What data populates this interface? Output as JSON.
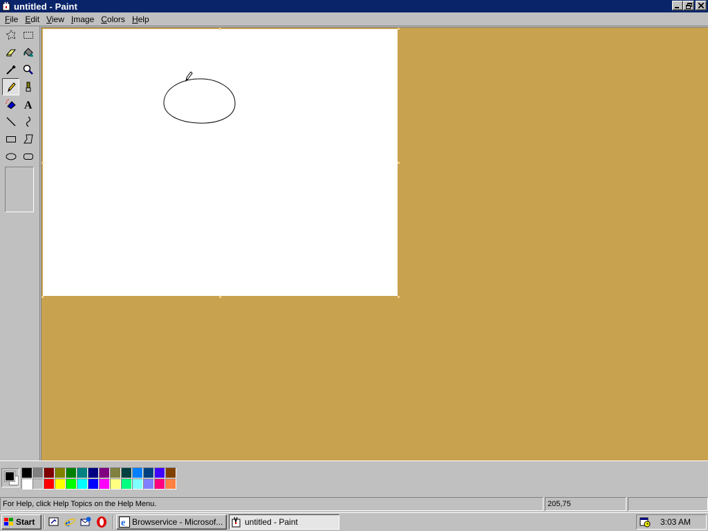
{
  "window": {
    "title": "untitled - Paint",
    "minimize_icon": "minimize-icon",
    "restore_icon": "restore-icon",
    "close_icon": "close-icon"
  },
  "menu": [
    {
      "label": "File",
      "accel": "F",
      "rest": "ile"
    },
    {
      "label": "Edit",
      "accel": "E",
      "rest": "dit"
    },
    {
      "label": "View",
      "accel": "V",
      "rest": "iew"
    },
    {
      "label": "Image",
      "accel": "I",
      "rest": "mage"
    },
    {
      "label": "Colors",
      "accel": "C",
      "rest": "olors"
    },
    {
      "label": "Help",
      "accel": "H",
      "rest": "elp"
    }
  ],
  "tools": [
    {
      "name": "free-form-select",
      "icon": "free-form-select-icon"
    },
    {
      "name": "select",
      "icon": "select-icon"
    },
    {
      "name": "eraser",
      "icon": "eraser-icon"
    },
    {
      "name": "fill-with-color",
      "icon": "paint-bucket-icon"
    },
    {
      "name": "pick-color",
      "icon": "eyedropper-icon"
    },
    {
      "name": "magnifier",
      "icon": "magnifier-icon"
    },
    {
      "name": "pencil",
      "icon": "pencil-icon",
      "active": true
    },
    {
      "name": "brush",
      "icon": "brush-icon"
    },
    {
      "name": "airbrush",
      "icon": "airbrush-icon"
    },
    {
      "name": "text",
      "icon": "text-icon",
      "glyph": "A"
    },
    {
      "name": "line",
      "icon": "line-icon"
    },
    {
      "name": "curve",
      "icon": "curve-icon"
    },
    {
      "name": "rectangle",
      "icon": "rectangle-icon"
    },
    {
      "name": "polygon",
      "icon": "polygon-icon"
    },
    {
      "name": "ellipse",
      "icon": "ellipse-icon"
    },
    {
      "name": "rounded-rectangle",
      "icon": "rounded-rectangle-icon"
    }
  ],
  "colors": {
    "workspace_bg": "#c9a250",
    "canvas_bg": "#ffffff",
    "titlebar": "#0a246a",
    "foreground": "#000000",
    "background": "#ffffff"
  },
  "palette": {
    "top": [
      "#000000",
      "#808080",
      "#800000",
      "#808000",
      "#008000",
      "#008080",
      "#000080",
      "#800080",
      "#808040",
      "#004040",
      "#0080ff",
      "#004080",
      "#4000ff",
      "#804000"
    ],
    "bottom": [
      "#ffffff",
      "#c0c0c0",
      "#ff0000",
      "#ffff00",
      "#00ff00",
      "#00ffff",
      "#0000ff",
      "#ff00ff",
      "#ffff80",
      "#00ff80",
      "#80ffff",
      "#8080ff",
      "#ff0080",
      "#ff8040"
    ]
  },
  "status": {
    "help_text": "For Help, click Help Topics on the Help Menu.",
    "coords": "205,75",
    "size": ""
  },
  "taskbar": {
    "start_label": "Start",
    "quick_launch": [
      "show-desktop-icon",
      "internet-explorer-icon",
      "outlook-express-icon",
      "opera-icon"
    ],
    "tasks": [
      {
        "label": "Browservice - Microsof...",
        "icon": "internet-explorer-icon",
        "active": false
      },
      {
        "label": "untitled - Paint",
        "icon": "paint-icon",
        "active": true
      }
    ],
    "tray_icon": "scheduler-icon",
    "clock": "3:03 AM"
  }
}
